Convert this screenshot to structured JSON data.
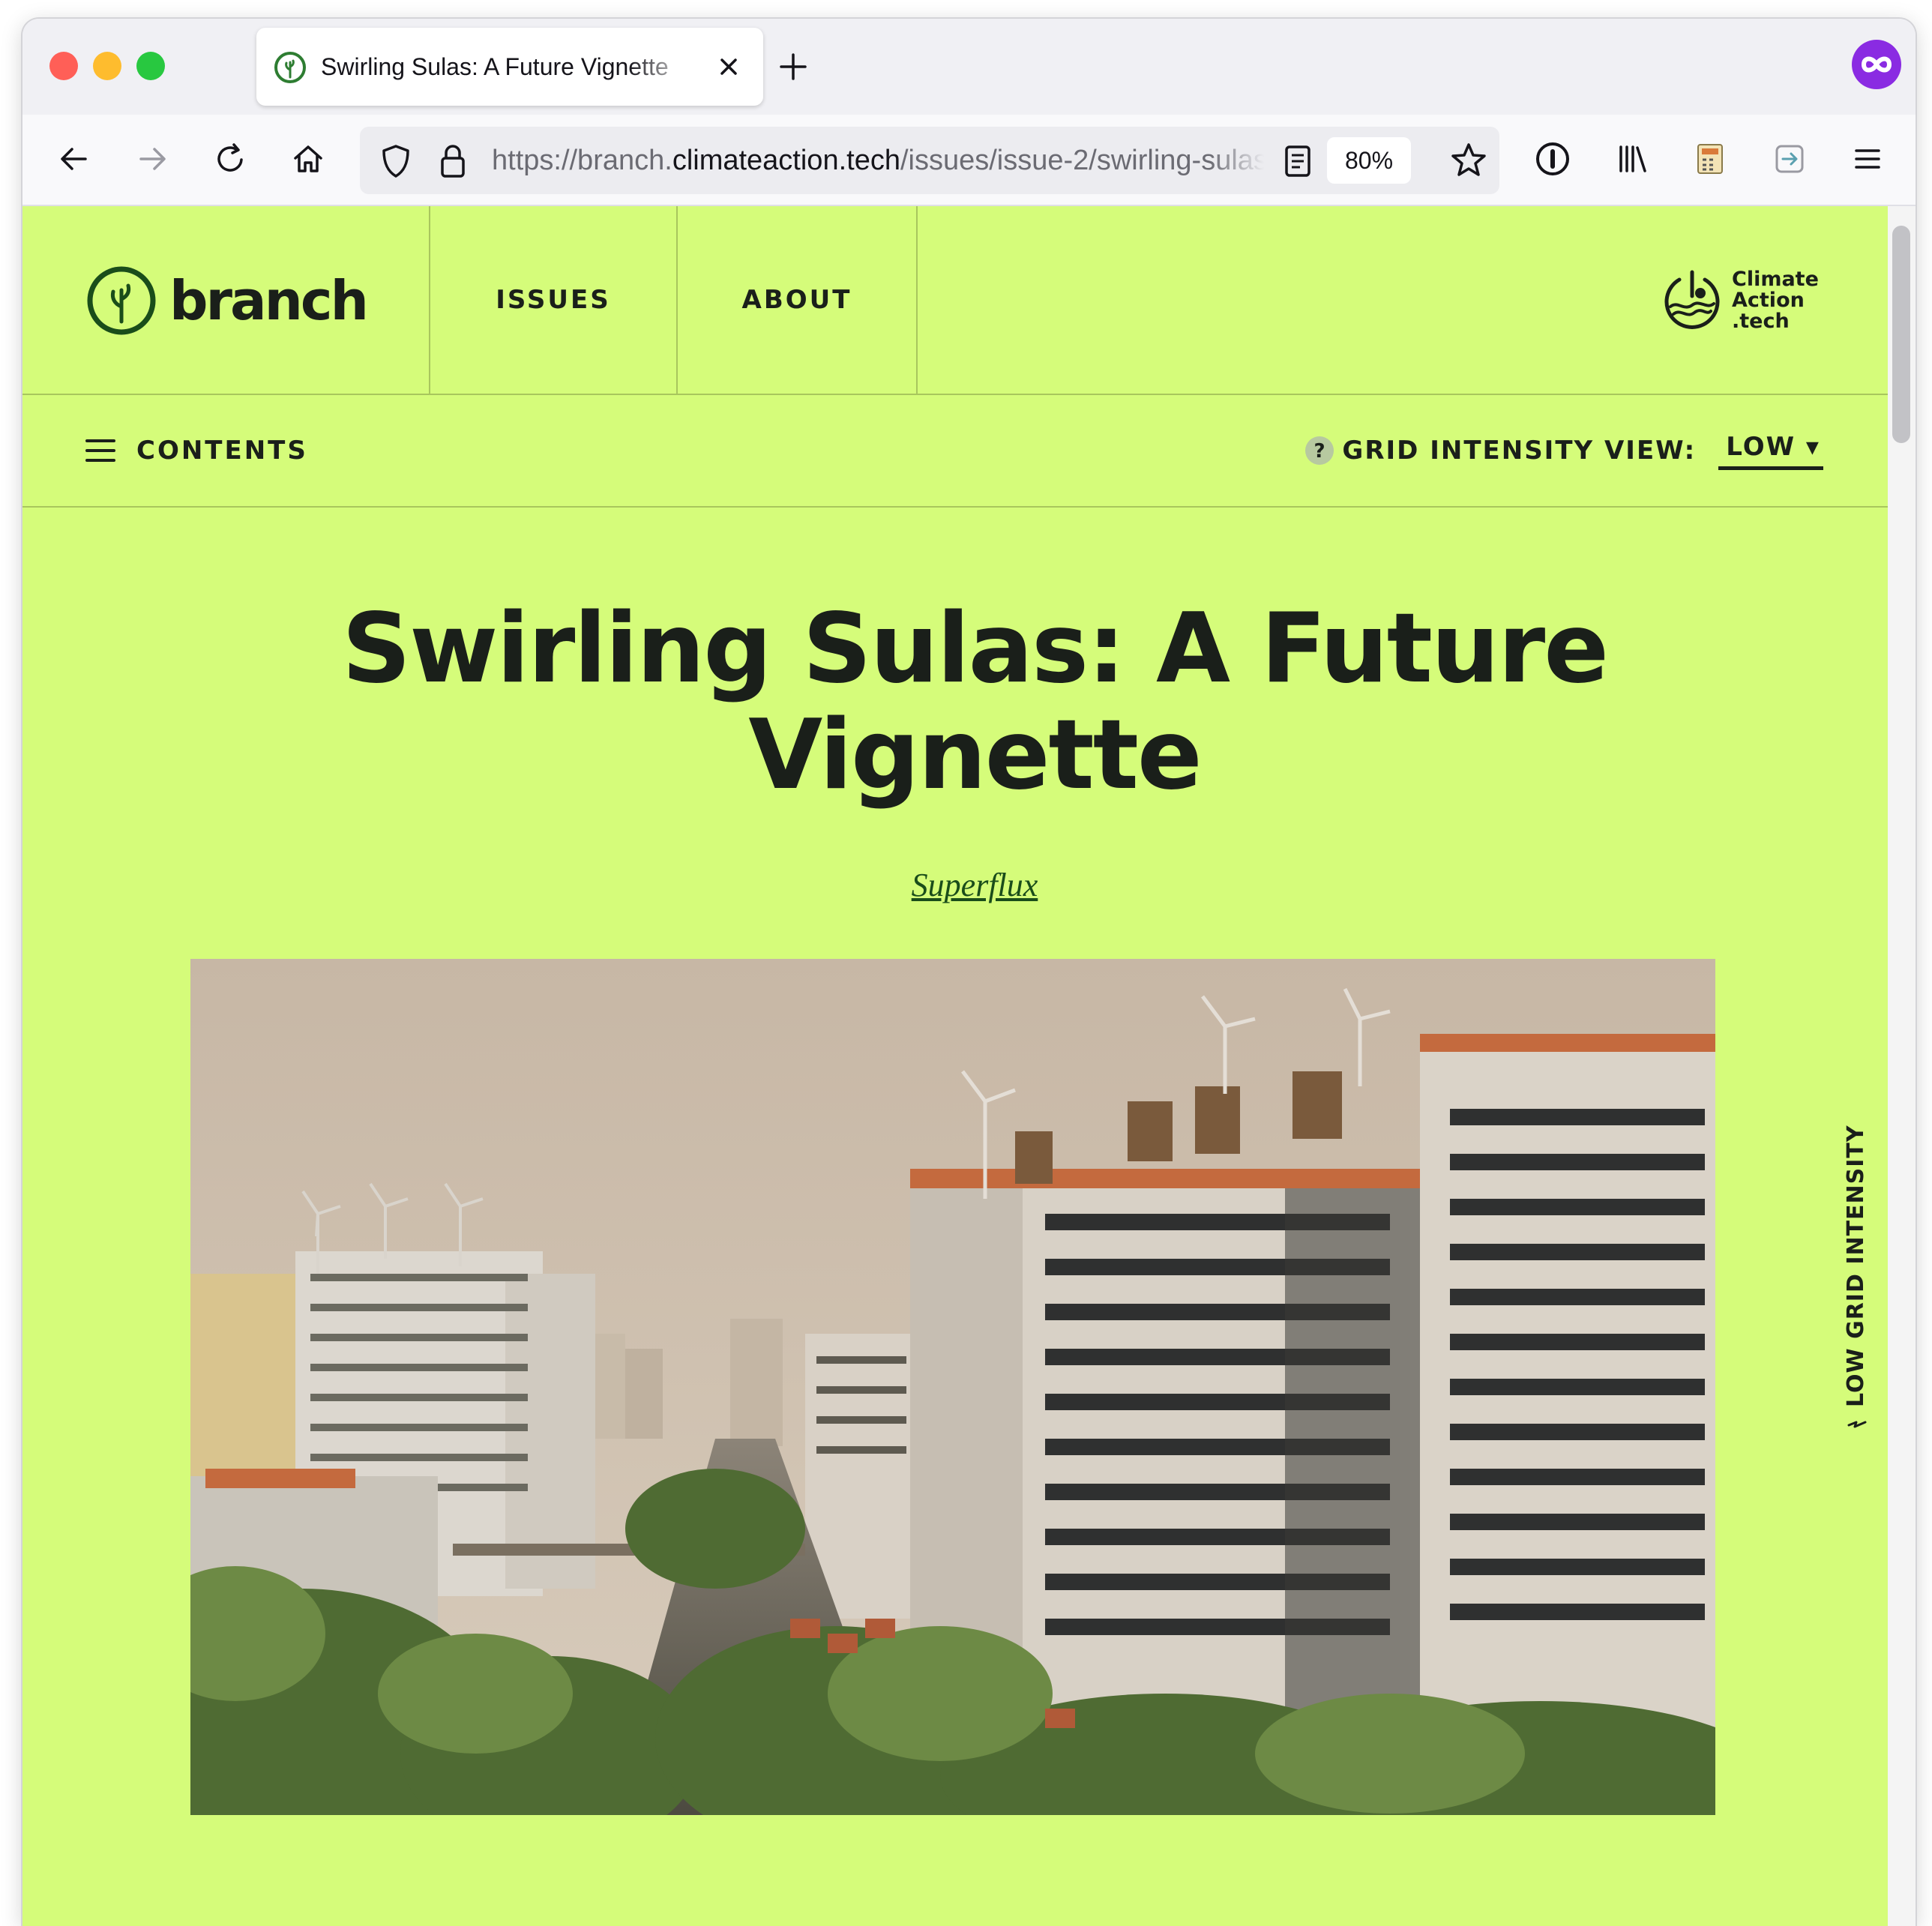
{
  "browser": {
    "tab": {
      "title": "Swirling Sulas: A Future Vignette"
    },
    "url": {
      "prefix": "https://branch.",
      "domain": "climateaction.tech",
      "path": "/issues/issue-2/swirling-sulas"
    },
    "zoom": "80%"
  },
  "site": {
    "logo_text": "branch",
    "nav": {
      "issues": "ISSUES",
      "about": "ABOUT"
    },
    "partner_logo": {
      "line1": "Climate",
      "line2": "Action",
      "line3": ".tech"
    },
    "contents_label": "CONTENTS",
    "grid_intensity": {
      "label": "GRID INTENSITY VIEW:",
      "selected": "LOW ▾"
    },
    "side_label": "LOW GRID INTENSITY"
  },
  "article": {
    "title": "Swirling Sulas: A Future Vignette",
    "author": "Superflux"
  },
  "colors": {
    "page_bg": "#d5fc7a",
    "text": "#1a1f1a",
    "accent_green": "#1a4d1a",
    "divider": "#a8c65d"
  }
}
